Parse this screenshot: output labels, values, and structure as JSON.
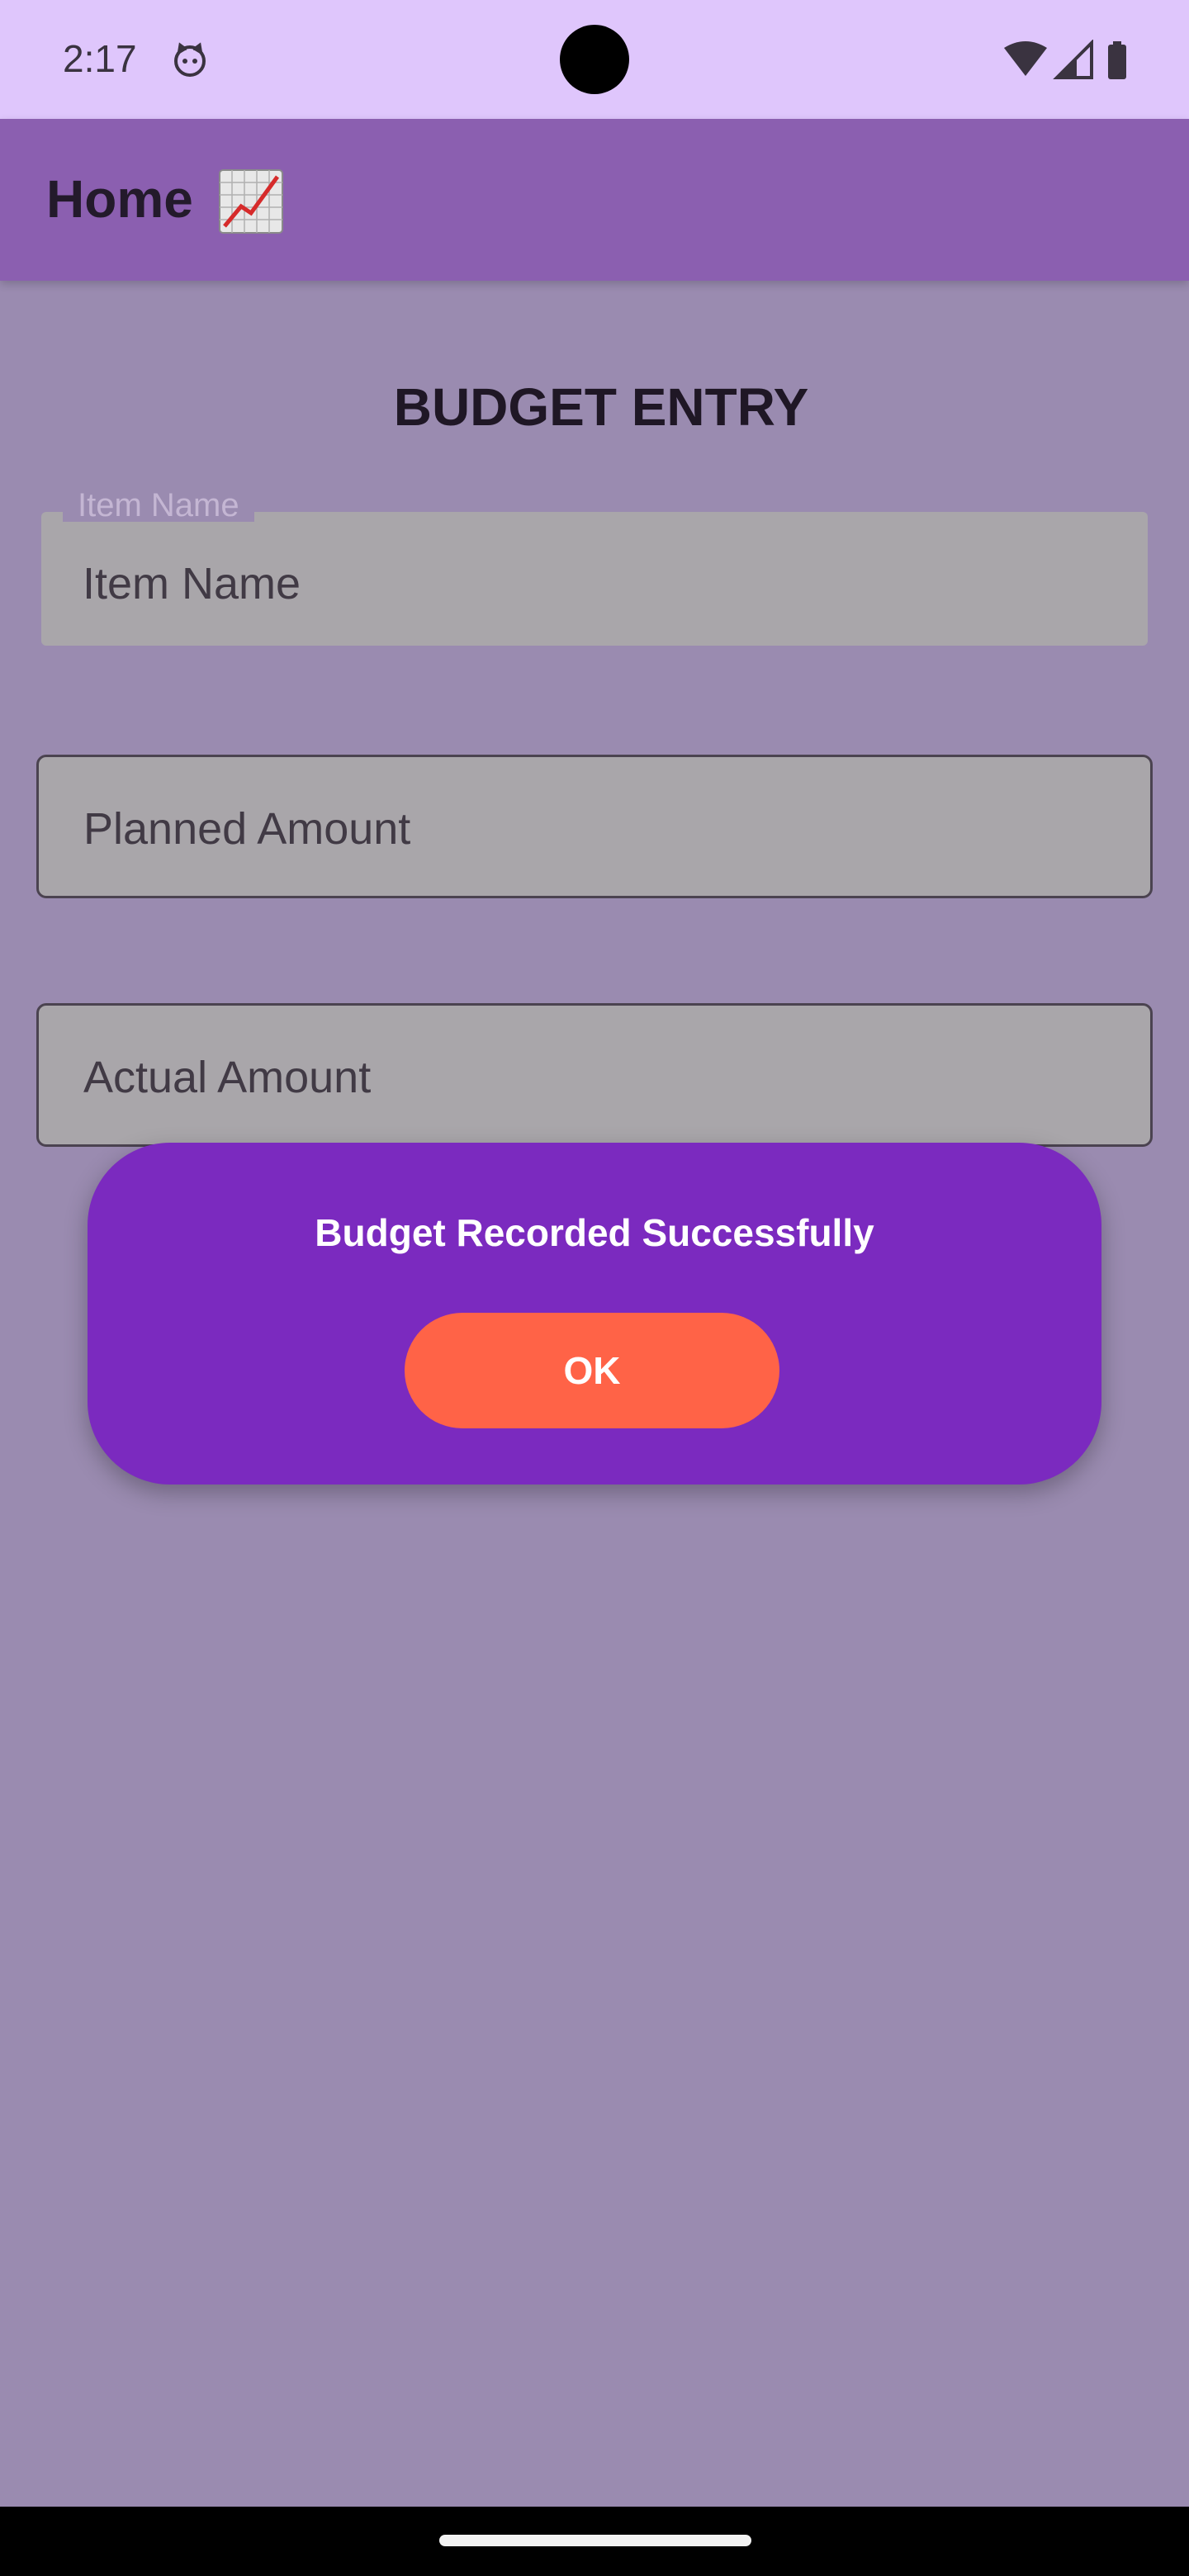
{
  "status_bar": {
    "time": "2:17",
    "icons": [
      "cat-notification-icon",
      "wifi-icon",
      "signal-icon",
      "battery-icon"
    ]
  },
  "app_bar": {
    "title": "Home",
    "title_icon": "chart-increasing-icon",
    "color": "#8b5fb0"
  },
  "form": {
    "heading": "BUDGET ENTRY",
    "item_name": {
      "floating_label": "Item Name",
      "placeholder": "Item Name"
    },
    "planned_amount": {
      "placeholder": "Planned Amount"
    },
    "actual_amount": {
      "placeholder": "Actual Amount"
    }
  },
  "dialog": {
    "message": "Budget Recorded Successfully",
    "ok_label": "OK",
    "background": "#7b2abf",
    "button_color": "#ff6347"
  }
}
